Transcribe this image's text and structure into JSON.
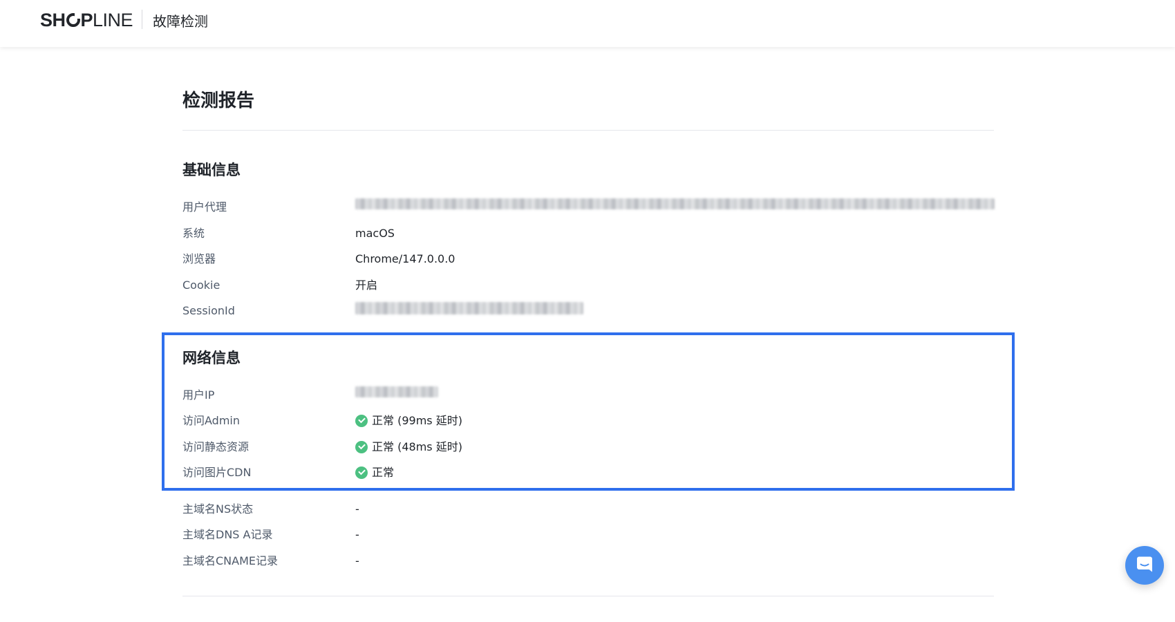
{
  "header": {
    "logo_bold": "SH",
    "logo_bold_tail": "P",
    "logo_light": "LINE",
    "page_title": "故障检测"
  },
  "report": {
    "title": "检测报告"
  },
  "basic_info": {
    "title": "基础信息",
    "rows": [
      {
        "label": "用户代理",
        "value": "",
        "redacted": true
      },
      {
        "label": "系统",
        "value": "macOS"
      },
      {
        "label": "浏览器",
        "value": "Chrome/147.0.0.0"
      },
      {
        "label": "Cookie",
        "value": "开启"
      },
      {
        "label": "SessionId",
        "value": "",
        "redacted": true
      }
    ]
  },
  "network_info": {
    "title": "网络信息",
    "rows": [
      {
        "label": "用户IP",
        "value": "",
        "redacted": true
      },
      {
        "label": "访问Admin",
        "value": "正常 (99ms 延时)",
        "status": "ok"
      },
      {
        "label": "访问静态资源",
        "value": "正常 (48ms 延时)",
        "status": "ok"
      },
      {
        "label": "访问图片CDN",
        "value": "正常",
        "status": "ok"
      },
      {
        "label": "主域名NS状态",
        "value": "-"
      },
      {
        "label": "主域名DNS A记录",
        "value": "-"
      },
      {
        "label": "主域名CNAME记录",
        "value": "-"
      }
    ]
  },
  "colors": {
    "highlight_border": "#2f6fed",
    "status_ok": "#4cc081",
    "chat_button": "#4a90f0"
  },
  "icons": {
    "status_ok": "check-circle-icon",
    "chat": "chat-icon"
  }
}
